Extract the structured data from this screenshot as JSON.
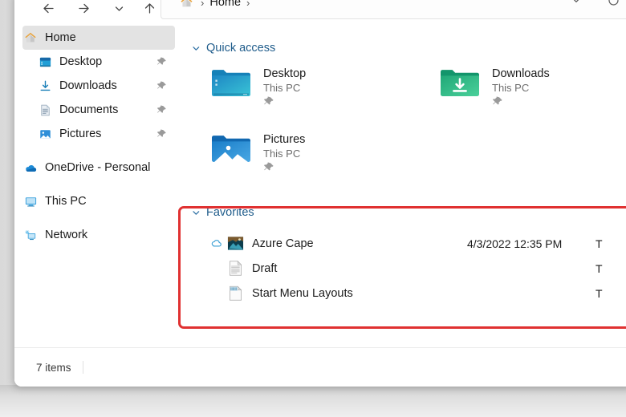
{
  "window": {
    "breadcrumb": {
      "home_icon": "home-icon",
      "label": "Home",
      "separator": "›"
    },
    "nav": {
      "back": "back-arrow-icon",
      "forward": "forward-arrow-icon",
      "recent": "chevron-down-icon",
      "up": "up-arrow-icon",
      "address_chevron": "chevron-down-icon",
      "refresh": "refresh-icon"
    }
  },
  "sidebar": {
    "items": [
      {
        "label": "Home",
        "icon": "home-icon",
        "selected": true,
        "pinned": false,
        "indent": false
      },
      {
        "label": "Desktop",
        "icon": "desktop-icon",
        "selected": false,
        "pinned": true,
        "indent": true
      },
      {
        "label": "Downloads",
        "icon": "download-icon",
        "selected": false,
        "pinned": true,
        "indent": true
      },
      {
        "label": "Documents",
        "icon": "documents-icon",
        "selected": false,
        "pinned": true,
        "indent": true
      },
      {
        "label": "Pictures",
        "icon": "pictures-icon",
        "selected": false,
        "pinned": true,
        "indent": true
      },
      {
        "label": "OneDrive - Personal",
        "icon": "onedrive-icon",
        "selected": false,
        "pinned": false,
        "indent": false
      },
      {
        "label": "This PC",
        "icon": "thispc-icon",
        "selected": false,
        "pinned": false,
        "indent": false
      },
      {
        "label": "Network",
        "icon": "network-icon",
        "selected": false,
        "pinned": false,
        "indent": false
      }
    ]
  },
  "quick_access": {
    "title": "Quick access",
    "chevron": "chevron-down-icon",
    "tiles": [
      {
        "name": "Desktop",
        "location": "This PC",
        "icon": "desktop-folder-icon",
        "pinned": true
      },
      {
        "name": "Downloads",
        "location": "This PC",
        "icon": "downloads-folder-icon",
        "pinned": true
      },
      {
        "name": "Pictures",
        "location": "This PC",
        "icon": "pictures-folder-icon",
        "pinned": true
      }
    ]
  },
  "favorites": {
    "title": "Favorites",
    "chevron": "chevron-down-icon",
    "highlight_color": "#e03131",
    "rows": [
      {
        "name": "Azure Cape",
        "date": "4/3/2022 12:35 PM",
        "type": "T",
        "icon": "image-file-icon",
        "cloud": "onedrive-cloud-icon"
      },
      {
        "name": "Draft",
        "date": "",
        "type": "T",
        "icon": "document-file-icon",
        "cloud": ""
      },
      {
        "name": "Start Menu Layouts",
        "date": "",
        "type": "T",
        "icon": "document-file-icon",
        "cloud": ""
      }
    ]
  },
  "status": {
    "item_count": "7 items"
  },
  "colors": {
    "accent_section": "#1f5c8b",
    "selection": "#e3e3e3",
    "highlight_red": "#e03131"
  }
}
